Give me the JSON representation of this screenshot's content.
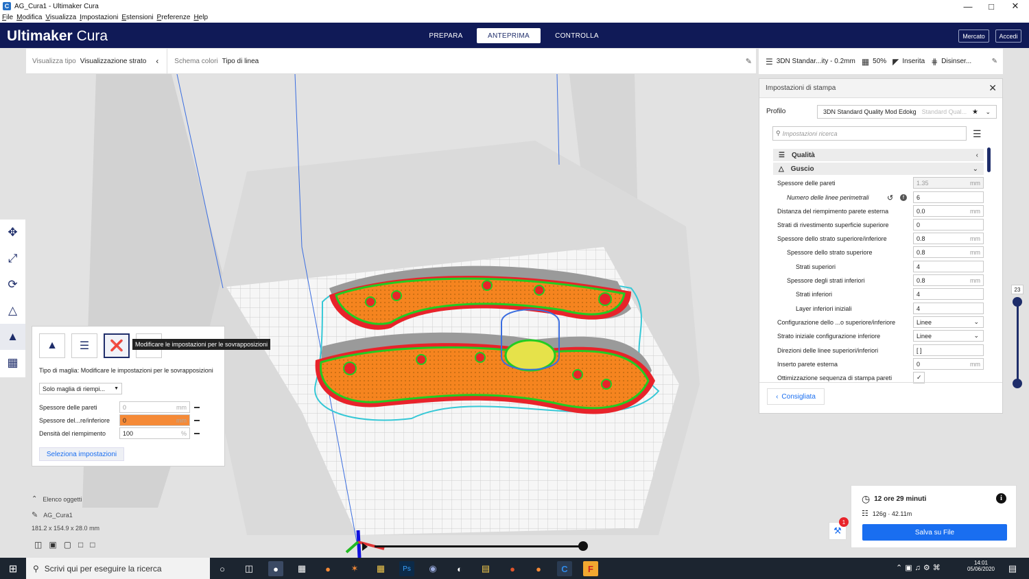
{
  "window": {
    "title": "AG_Cura1 - Ultimaker Cura",
    "app_icon": "cura-icon",
    "controls": [
      "minimize",
      "maximize",
      "close"
    ]
  },
  "menu": [
    "File",
    "Modifica",
    "Visualizza",
    "Impostazioni",
    "Estensioni",
    "Preferenze",
    "Help"
  ],
  "header": {
    "brand_strong": "Ultimaker",
    "brand_light": "Cura",
    "stages": [
      "PREPARA",
      "ANTEPRIMA",
      "CONTROLLA"
    ],
    "active_stage": "ANTEPRIMA",
    "marketplace": "Mercato",
    "signin": "Accedi"
  },
  "viewbar": {
    "view_type_label": "Visualizza tipo",
    "view_type_value": "Visualizzazione strato",
    "color_scheme_label": "Schema colori",
    "color_scheme_value": "Tipo di linea"
  },
  "printbar": {
    "profile": "3DN Standar...ity - 0.2mm",
    "infill": "50%",
    "support": "Inserita",
    "adhesion": "Disinser..."
  },
  "settings": {
    "title": "Impostazioni di stampa",
    "profile_label": "Profilo",
    "profile_value": "3DN Standard Quality Mod Edokg",
    "profile_hint": "Standard Qual...",
    "search_placeholder": "Impostazioni ricerca",
    "categories": [
      "Qualità",
      "Guscio"
    ],
    "rows": [
      {
        "label": "Spessore delle pareti",
        "value": "1.35",
        "unit": "mm"
      },
      {
        "label": "Numero delle linee perimetrali",
        "value": "6",
        "unit": ""
      },
      {
        "label": "Distanza del riempimento parete esterna",
        "value": "0.0",
        "unit": "mm"
      },
      {
        "label": "Strati di rivestimento superficie superiore",
        "value": "0",
        "unit": ""
      },
      {
        "label": "Spessore dello strato superiore/inferiore",
        "value": "0.8",
        "unit": "mm"
      },
      {
        "label": "Spessore dello strato superiore",
        "value": "0.8",
        "unit": "mm"
      },
      {
        "label": "Strati superiori",
        "value": "4",
        "unit": ""
      },
      {
        "label": "Spessore degli strati inferiori",
        "value": "0.8",
        "unit": "mm"
      },
      {
        "label": "Strati inferiori",
        "value": "4",
        "unit": ""
      },
      {
        "label": "Layer inferiori iniziali",
        "value": "4",
        "unit": ""
      },
      {
        "label": "Configurazione dello ...o superiore/inferiore",
        "value": "Linee",
        "unit": ""
      },
      {
        "label": "Strato iniziale configurazione inferiore",
        "value": "Linee",
        "unit": ""
      },
      {
        "label": "Direzioni delle linee superiori/inferiori",
        "value": "[ ]",
        "unit": ""
      },
      {
        "label": "Inserto parete esterna",
        "value": "0",
        "unit": "mm"
      },
      {
        "label": "Ottimizzazione sequenza di stampa pareti",
        "value": "✓",
        "unit": ""
      }
    ],
    "recommended": "Consigliata"
  },
  "layer_slider": {
    "value": "23"
  },
  "tool_panel": {
    "tooltip": "Modificare le impostazioni per le sovrapposizioni",
    "mesh_type_text": "Tipo di maglia: Modificare le impostazioni per le sovrapposizioni",
    "dropdown": "Solo maglia di riempi...",
    "fields": [
      {
        "label": "Spessore delle pareti",
        "value": "0",
        "unit": "mm"
      },
      {
        "label": "Spessore del...re/inferiore",
        "value": "0",
        "unit": "mm"
      },
      {
        "label": "Densità del riempimento",
        "value": "100",
        "unit": "%"
      }
    ],
    "select_button": "Seleziona impostazioni"
  },
  "objects": {
    "header": "Elenco oggetti",
    "name": "AG_Cura1",
    "dims": "181.2 x 154.9 x 28.0 mm"
  },
  "estimate": {
    "time": "12 ore 29 minuti",
    "material": "126g · 42.11m",
    "save": "Salva su File",
    "badge": "1"
  },
  "taskbar": {
    "search": "Scrivi qui per eseguire la ricerca",
    "time": "14:01",
    "date": "05/06/2020"
  },
  "colors": {
    "header": "#101a57",
    "accent": "#196ef0",
    "infill": "#f5841f",
    "wall": "#e8232a",
    "inner_wall": "#22cc22",
    "skirt": "#35c8d6"
  }
}
